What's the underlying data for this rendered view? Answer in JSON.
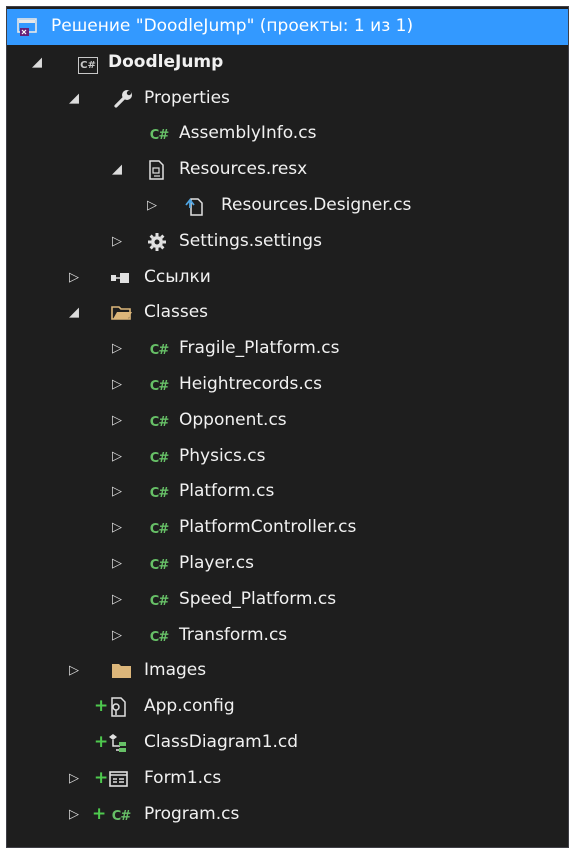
{
  "window": {
    "panel": "Solution Explorer"
  },
  "colors": {
    "background": "#1e1e1e",
    "selection": "#3399ff",
    "text": "#f1f1f1",
    "csharp_green": "#67c067",
    "folder": "#dcb67a"
  },
  "tree": {
    "solution": "Решение \"DoodleJump\" (проекты: 1 из 1)",
    "project": "DoodleJump",
    "properties": "Properties",
    "assemblyinfo": "AssemblyInfo.cs",
    "resources_resx": "Resources.resx",
    "resources_designer": "Resources.Designer.cs",
    "settings": "Settings.settings",
    "references": "Ссылки",
    "classes": "Classes",
    "fragile_platform": "Fragile_Platform.cs",
    "heightrecords": "Heightrecords.cs",
    "opponent": "Opponent.cs",
    "physics": "Physics.cs",
    "platform": "Platform.cs",
    "platform_controller": "PlatformController.cs",
    "player": "Player.cs",
    "speed_platform": "Speed_Platform.cs",
    "transform": "Transform.cs",
    "images": "Images",
    "app_config": "App.config",
    "class_diagram": "ClassDiagram1.cd",
    "form1": "Form1.cs",
    "program": "Program.cs"
  },
  "icons": {
    "expanded": "expanded-arrow",
    "collapsed": "collapsed-arrow",
    "csharp_file": "C#",
    "csharp_project": "C#",
    "added_marker": "+"
  }
}
